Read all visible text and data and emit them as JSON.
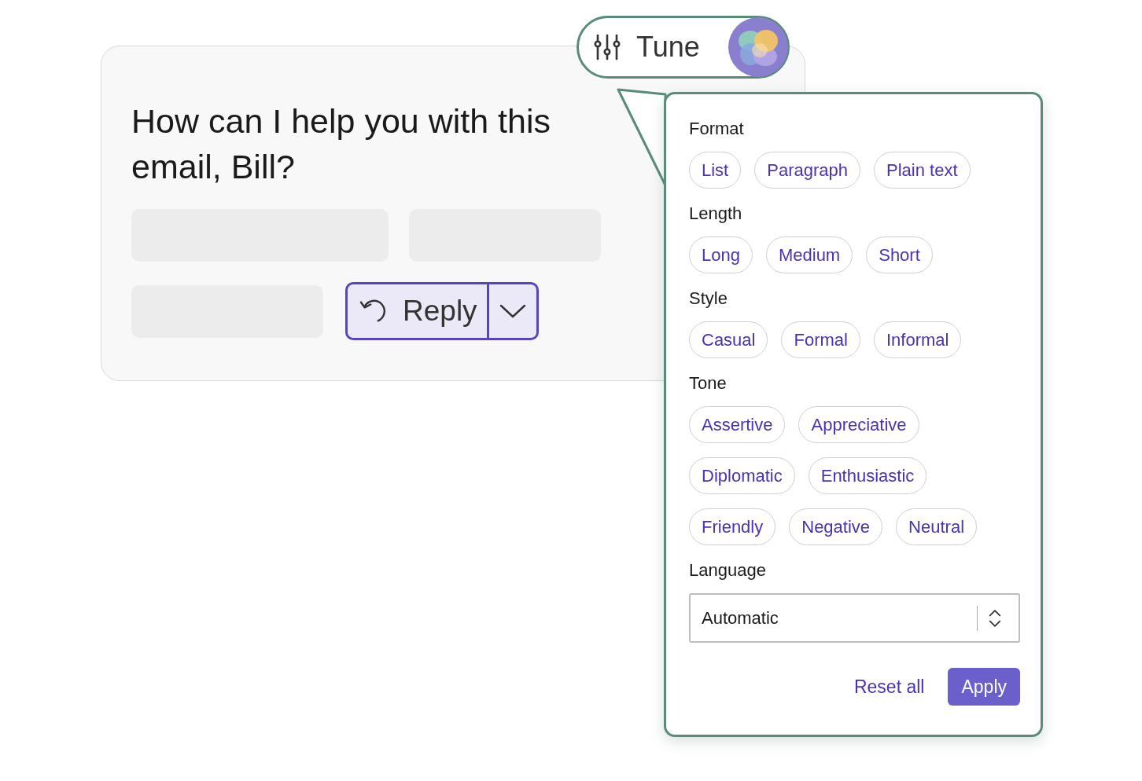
{
  "prompt_card": {
    "question": "How can I help you with this email, Bill?",
    "reply_button": {
      "label": "Reply"
    }
  },
  "tune_button": {
    "label": "Tune"
  },
  "tune_panel": {
    "sections": [
      {
        "title": "Format",
        "rows": [
          [
            "List",
            "Paragraph",
            "Plain text"
          ]
        ]
      },
      {
        "title": "Length",
        "rows": [
          [
            "Long",
            "Medium",
            "Short"
          ]
        ]
      },
      {
        "title": "Style",
        "rows": [
          [
            "Casual",
            "Formal",
            "Informal"
          ]
        ]
      },
      {
        "title": "Tone",
        "rows": [
          [
            "Assertive",
            "Appreciative"
          ],
          [
            "Diplomatic",
            "Enthusiastic"
          ],
          [
            "Friendly",
            "Negative",
            "Neutral"
          ]
        ]
      }
    ],
    "language": {
      "label": "Language",
      "value": "Automatic"
    },
    "buttons": {
      "reset": "Reset all",
      "apply": "Apply"
    }
  }
}
